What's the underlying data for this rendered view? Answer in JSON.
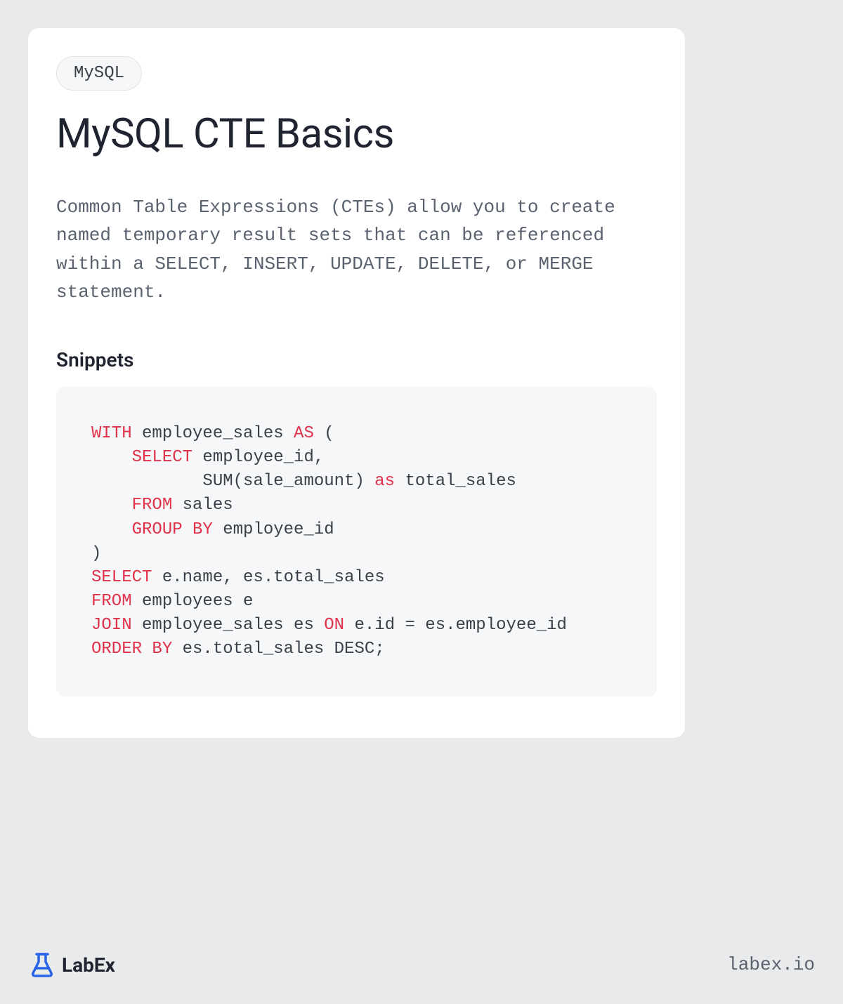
{
  "card": {
    "tag": "MySQL",
    "title": "MySQL CTE Basics",
    "description": "Common Table Expressions (CTEs) allow you to create named temporary result sets that can be referenced within a SELECT, INSERT, UPDATE, DELETE, or MERGE statement.",
    "section_heading": "Snippets",
    "code": {
      "tokens": [
        {
          "t": "WITH",
          "kw": true
        },
        {
          "t": " employee_sales "
        },
        {
          "t": "AS",
          "kw": true
        },
        {
          "t": " (\n    "
        },
        {
          "t": "SELECT",
          "kw": true
        },
        {
          "t": " employee_id,\n           SUM(sale_amount) "
        },
        {
          "t": "as",
          "kw": true
        },
        {
          "t": " total_sales\n    "
        },
        {
          "t": "FROM",
          "kw": true
        },
        {
          "t": " sales\n    "
        },
        {
          "t": "GROUP BY",
          "kw": true
        },
        {
          "t": " employee_id\n)\n"
        },
        {
          "t": "SELECT",
          "kw": true
        },
        {
          "t": " e.name, es.total_sales\n"
        },
        {
          "t": "FROM",
          "kw": true
        },
        {
          "t": " employees e\n"
        },
        {
          "t": "JOIN",
          "kw": true
        },
        {
          "t": " employee_sales es "
        },
        {
          "t": "ON",
          "kw": true
        },
        {
          "t": " e.id = es.employee_id\n"
        },
        {
          "t": "ORDER BY",
          "kw": true
        },
        {
          "t": " es.total_sales DESC;"
        }
      ]
    }
  },
  "footer": {
    "brand": "LabEx",
    "url": "labex.io"
  }
}
